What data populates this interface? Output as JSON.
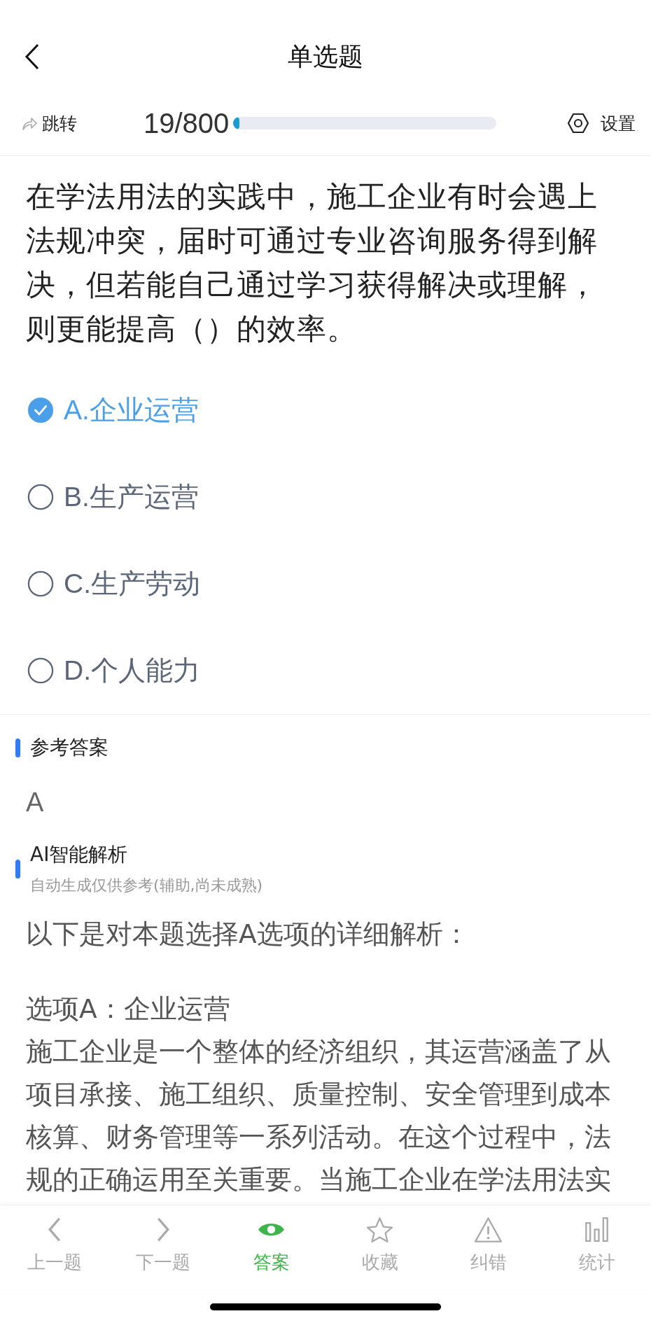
{
  "header": {
    "title": "单选题"
  },
  "toolbar": {
    "jump": "跳转",
    "progress_text": "19/800",
    "progress": {
      "level": 0.024
    },
    "settings": "设置"
  },
  "question": {
    "text": "在学法用法的实践中，施工企业有时会遇上法规冲突，届时可通过专业咨询服务得到解决，但若能自己通过学习获得解决或理解，则更能提高（）的效率。",
    "options": [
      {
        "label": "A.企业运营",
        "selected": true
      },
      {
        "label": "B.生产运营",
        "selected": false
      },
      {
        "label": "C.生产劳动",
        "selected": false
      },
      {
        "label": "D.个人能力",
        "selected": false
      }
    ]
  },
  "answer": {
    "heading": "参考答案",
    "value": "A"
  },
  "analysis": {
    "heading": "AI智能解析",
    "subtitle": "自动生成仅供参考(辅助,尚未成熟)",
    "paragraphs": [
      "以下是对本题选择A选项的详细解析：",
      "选项A：企业运营",
      "施工企业是一个整体的经济组织，其运营涵盖了从项目承接、施工组织、质量控制、安全管理到成本核算、财务管理等一系列活动。在这个过程中，法规的正确运用至关重要。当施工企业在学法用法实"
    ]
  },
  "tab_bar": [
    {
      "label": "上一题",
      "selected": false
    },
    {
      "label": "下一题",
      "selected": false
    },
    {
      "label": "答案",
      "selected": true
    },
    {
      "label": "收藏",
      "selected": false
    },
    {
      "label": "纠错",
      "selected": false
    },
    {
      "label": "统计",
      "selected": false
    }
  ]
}
